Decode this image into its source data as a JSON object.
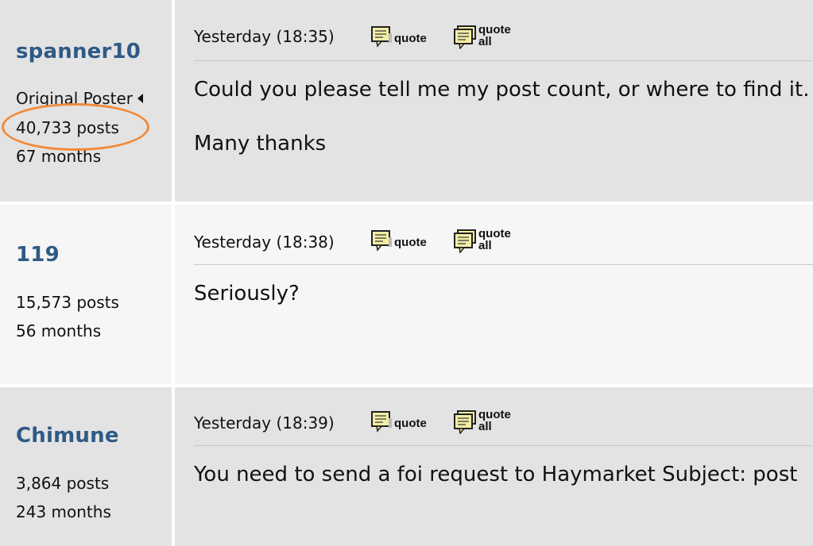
{
  "colors": {
    "username": "#2f5a86",
    "post_bg_odd": "#e3e3e3",
    "post_bg_even": "#f6f6f6",
    "highlight": "#f08a3a"
  },
  "buttons": {
    "quote_label": "quote",
    "quote_all_line1": "quote",
    "quote_all_line2": "all",
    "quote_icon": "speech-bubble-quote-icon",
    "quote_all_icon": "speech-bubble-quote-all-icon"
  },
  "posts": [
    {
      "username": "spanner10",
      "role": "Original Poster",
      "posts": "40,733 posts",
      "months": "67 months",
      "time": "Yesterday (18:35)",
      "message_lines": [
        "Could you please tell me my post count, or where to find it.",
        "Many thanks"
      ]
    },
    {
      "username": "119",
      "posts": "15,573 posts",
      "months": "56 months",
      "time": "Yesterday (18:38)",
      "message_lines": [
        "Seriously?"
      ]
    },
    {
      "username": "Chimune",
      "posts": "3,864 posts",
      "months": "243 months",
      "time": "Yesterday (18:39)",
      "message_lines": [
        "You need to send a foi request to Haymarket Subject: post"
      ]
    }
  ]
}
